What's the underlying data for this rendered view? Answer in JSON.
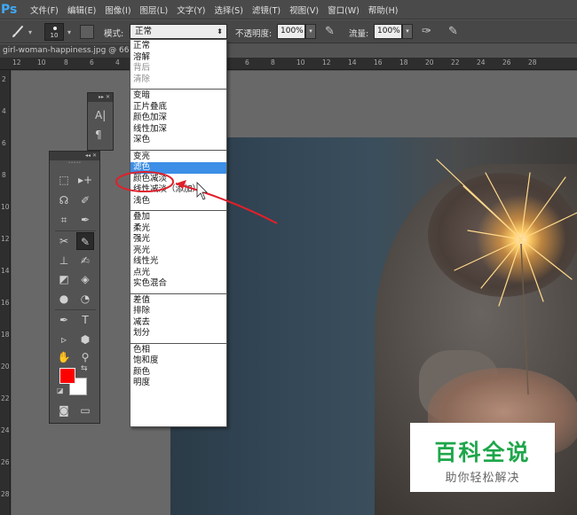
{
  "app": {
    "logo": "Ps"
  },
  "menubar": {
    "items": [
      "文件(F)",
      "编辑(E)",
      "图像(I)",
      "图层(L)",
      "文字(Y)",
      "选择(S)",
      "滤镜(T)",
      "视图(V)",
      "窗口(W)",
      "帮助(H)"
    ]
  },
  "options_bar": {
    "brush_size": "10",
    "mode_label": "模式:",
    "mode_value": "正常",
    "opacity_label": "不透明度:",
    "opacity_value": "100%",
    "flow_label": "流量:",
    "flow_value": "100%"
  },
  "document": {
    "tab_title": "girl-woman-happiness.jpg @ 66"
  },
  "rulers": {
    "horizontal": [
      "12",
      "10",
      "8",
      "6",
      "4",
      "2",
      "0",
      "2",
      "4",
      "6",
      "8",
      "10",
      "12",
      "14",
      "16",
      "18",
      "20",
      "22",
      "24",
      "26",
      "28"
    ],
    "vertical": [
      "2",
      "4",
      "6",
      "8",
      "10",
      "12",
      "14",
      "16",
      "18",
      "20",
      "22",
      "24",
      "26",
      "28"
    ]
  },
  "blend_modes": {
    "groups": [
      {
        "options": [
          {
            "label": "正常",
            "disabled": false
          },
          {
            "label": "溶解",
            "disabled": false
          },
          {
            "label": "背后",
            "disabled": true
          },
          {
            "label": "清除",
            "disabled": true
          }
        ]
      },
      {
        "options": [
          {
            "label": "变暗",
            "disabled": false
          },
          {
            "label": "正片叠底",
            "disabled": false
          },
          {
            "label": "颜色加深",
            "disabled": false
          },
          {
            "label": "线性加深",
            "disabled": false
          },
          {
            "label": "深色",
            "disabled": false
          }
        ]
      },
      {
        "options": [
          {
            "label": "变亮",
            "disabled": false
          },
          {
            "label": "滤色",
            "disabled": false,
            "selected": true
          },
          {
            "label": "颜色减淡",
            "disabled": false
          },
          {
            "label": "线性减淡（添加）",
            "disabled": false
          },
          {
            "label": "浅色",
            "disabled": false
          }
        ]
      },
      {
        "options": [
          {
            "label": "叠加",
            "disabled": false
          },
          {
            "label": "柔光",
            "disabled": false
          },
          {
            "label": "强光",
            "disabled": false
          },
          {
            "label": "亮光",
            "disabled": false
          },
          {
            "label": "线性光",
            "disabled": false
          },
          {
            "label": "点光",
            "disabled": false
          },
          {
            "label": "实色混合",
            "disabled": false
          }
        ]
      },
      {
        "options": [
          {
            "label": "差值",
            "disabled": false
          },
          {
            "label": "排除",
            "disabled": false
          },
          {
            "label": "减去",
            "disabled": false
          },
          {
            "label": "划分",
            "disabled": false
          }
        ]
      },
      {
        "options": [
          {
            "label": "色相",
            "disabled": false
          },
          {
            "label": "饱和度",
            "disabled": false
          },
          {
            "label": "颜色",
            "disabled": false
          },
          {
            "label": "明度",
            "disabled": false
          }
        ]
      }
    ]
  },
  "toolbox": {
    "foreground_color": "#ff0000",
    "background_color": "#ffffff"
  },
  "annotation": {
    "color": "#e0202a"
  },
  "watermark": {
    "title": "百科全说",
    "subtitle": "助你轻松解决",
    "title_color": "#1ea64a"
  }
}
